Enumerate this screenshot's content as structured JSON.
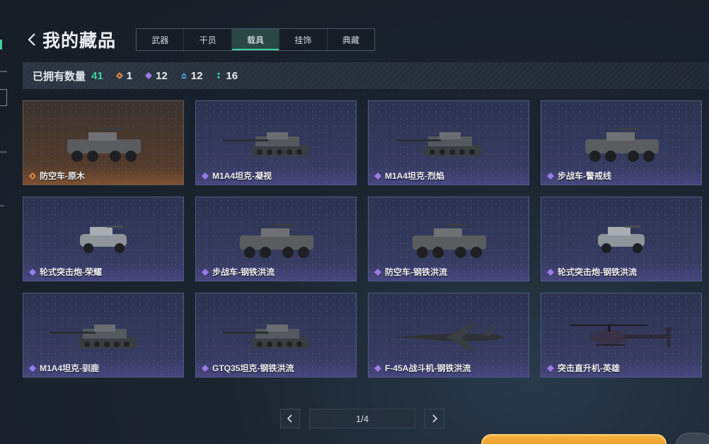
{
  "header": {
    "title": "我的藏品"
  },
  "tabs": [
    {
      "label": "武器",
      "active": false
    },
    {
      "label": "干员",
      "active": false
    },
    {
      "label": "载具",
      "active": true
    },
    {
      "label": "挂饰",
      "active": false
    },
    {
      "label": "典藏",
      "active": false
    }
  ],
  "stats": {
    "label": "已拥有数量",
    "total": "41",
    "rarities": [
      {
        "icon": "orange-diamond-icon",
        "color": "#e08a4a",
        "count": "1"
      },
      {
        "icon": "purple-diamond-icon",
        "color": "#9b7be8",
        "count": "12"
      },
      {
        "icon": "blue-chevron-icon",
        "color": "#5aa8e8",
        "count": "12"
      },
      {
        "icon": "green-dots-icon",
        "color": "#3ad29f",
        "count": "16"
      }
    ]
  },
  "items": [
    {
      "name": "防空车-原木",
      "rarity": "orange",
      "kind": "apc"
    },
    {
      "name": "M1A4坦克-凝视",
      "rarity": "purple",
      "kind": "tank"
    },
    {
      "name": "M1A4坦克-烈焰",
      "rarity": "purple",
      "kind": "tank"
    },
    {
      "name": "步战车-警戒线",
      "rarity": "purple",
      "kind": "apc"
    },
    {
      "name": "轮式突击炮-荣耀",
      "rarity": "purple",
      "kind": "buggy"
    },
    {
      "name": "步战车-钢铁洪流",
      "rarity": "purple",
      "kind": "apc"
    },
    {
      "name": "防空车-钢铁洪流",
      "rarity": "purple",
      "kind": "apc"
    },
    {
      "name": "轮式突击炮-钢铁洪流",
      "rarity": "purple",
      "kind": "buggy"
    },
    {
      "name": "M1A4坦克-驯鹿",
      "rarity": "purple",
      "kind": "tank"
    },
    {
      "name": "GTQ35坦克-钢铁洪流",
      "rarity": "purple",
      "kind": "tank"
    },
    {
      "name": "F-45A战斗机-钢铁洪流",
      "rarity": "purple",
      "kind": "jet"
    },
    {
      "name": "突击直升机-英雄",
      "rarity": "purple",
      "kind": "heli"
    }
  ],
  "pagination": {
    "text": "1/4"
  }
}
